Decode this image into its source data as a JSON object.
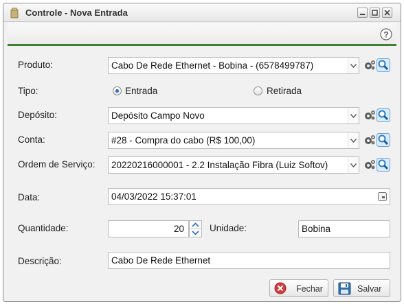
{
  "window": {
    "title": "Controle - Nova Entrada",
    "controls": [
      "minimize",
      "maximize",
      "close"
    ]
  },
  "toolbar": {
    "help_label": "?"
  },
  "form": {
    "produto": {
      "label": "Produto:",
      "value": "Cabo De Rede Ethernet - Bobina - (6578499787)"
    },
    "tipo": {
      "label": "Tipo:",
      "options": [
        {
          "label": "Entrada",
          "selected": true
        },
        {
          "label": "Retirada",
          "selected": false
        }
      ]
    },
    "deposito": {
      "label": "Depósito:",
      "value": "Depósito Campo Novo"
    },
    "conta": {
      "label": "Conta:",
      "value": "#28 - Compra do cabo (R$ 100,00)"
    },
    "ordem_servico": {
      "label": "Ordem de Serviço:",
      "value": "20220216000001 - 2.2 Instalação Fibra (Luiz Softov)"
    },
    "data": {
      "label": "Data:",
      "value": "04/03/2022 15:37:01"
    },
    "quantidade": {
      "label": "Quantidade:",
      "value": "20"
    },
    "unidade": {
      "label": "Unidade:",
      "value": "Bobina"
    },
    "descricao": {
      "label": "Descrição:",
      "value": "Cabo De Rede Ethernet"
    }
  },
  "buttons": {
    "fechar": "Fechar",
    "salvar": "Salvar"
  },
  "colors": {
    "accent_bar": "#3f7f32",
    "search_icon": "#2a7fd4",
    "close_icon": "#d63a3a",
    "radio_selected": "#2d6db5"
  }
}
